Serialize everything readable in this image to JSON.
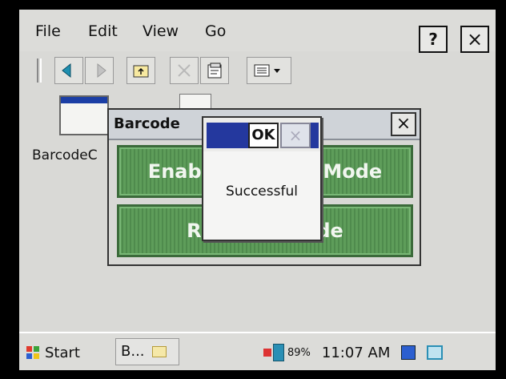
{
  "menu": {
    "file": "File",
    "edit": "Edit",
    "view": "View",
    "go": "Go"
  },
  "titlebar": {
    "help": "?",
    "close": "×"
  },
  "toolbar": {
    "icons": [
      "back-icon",
      "forward-icon",
      "up-folder-icon",
      "delete-icon",
      "properties-icon",
      "view-options-icon"
    ]
  },
  "desktop": {
    "file_label": "BarcodeC"
  },
  "barcode_window": {
    "title": "Barcode",
    "close": "×",
    "enable_button": "Enable Barcode Mode",
    "reset_button": "Reset Barcode"
  },
  "message_dialog": {
    "ok": "OK",
    "close": "×",
    "text": "Successful"
  },
  "taskbar": {
    "start": "Start",
    "task_label": "B...",
    "battery": "89%",
    "clock": "11:07 AM"
  },
  "colors": {
    "accent_blue": "#24389e",
    "button_green": "#5e9d5a"
  }
}
